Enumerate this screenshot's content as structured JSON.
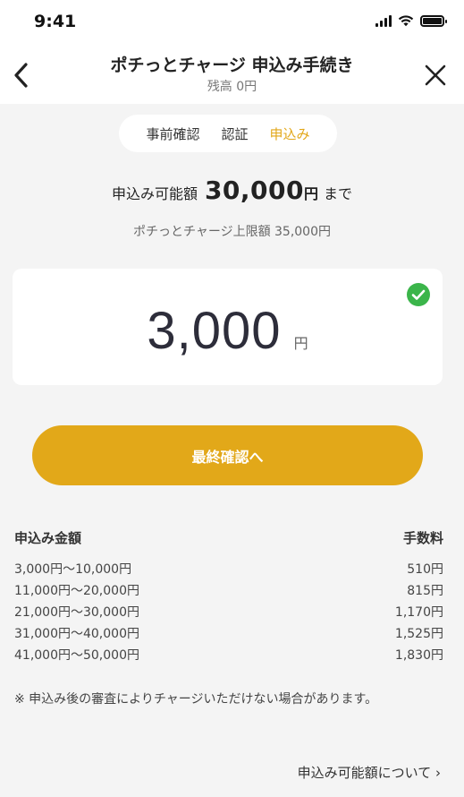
{
  "status": {
    "time": "9:41"
  },
  "header": {
    "title": "ポチっとチャージ 申込み手続き",
    "subtitle": "残高 0円"
  },
  "steps": [
    {
      "label": "事前確認"
    },
    {
      "label": "認証"
    },
    {
      "label": "申込み",
      "active": true
    }
  ],
  "availability": {
    "prefix": "申込み可能額",
    "amount": "30,000",
    "unit": "円",
    "suffix": "まで",
    "limit_text": "ポチっとチャージ上限額 35,000円"
  },
  "amount_input": {
    "value": "3,000",
    "unit": "円"
  },
  "confirm_button": {
    "label": "最終確認へ"
  },
  "fee_table": {
    "col_amount": "申込み金額",
    "col_fee": "手数料",
    "rows": [
      {
        "range": "3,000円〜10,000円",
        "fee": "510円"
      },
      {
        "range": "11,000円〜20,000円",
        "fee": "815円"
      },
      {
        "range": "21,000円〜30,000円",
        "fee": "1,170円"
      },
      {
        "range": "31,000円〜40,000円",
        "fee": "1,525円"
      },
      {
        "range": "41,000円〜50,000円",
        "fee": "1,830円"
      }
    ]
  },
  "note": "※ 申込み後の審査によりチャージいただけない場合があります。",
  "about_link": "申込み可能額について ›",
  "colors": {
    "accent": "#e2a819",
    "check": "#3bb54a"
  }
}
